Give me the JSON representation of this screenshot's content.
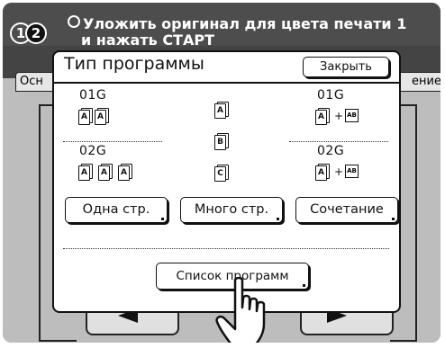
{
  "status": {
    "step1": "1",
    "step2": "2",
    "message_line1": "Уложить оригинал для цвета печати 1",
    "message_line2": "и нажать СТАРТ"
  },
  "background": {
    "tab_left_label": "Осн",
    "tab_right_label": "ение"
  },
  "dialog": {
    "title": "Тип программы",
    "close_label": "Закрыть",
    "single": {
      "code1": "01G",
      "code2": "02G",
      "button_label": "Одна стр."
    },
    "multi": {
      "icons": [
        "A",
        "B",
        "C"
      ],
      "button_label": "Много стр."
    },
    "combo": {
      "code1": "01G",
      "code2": "02G",
      "plus": "+",
      "ab": "AB",
      "button_label": "Сочетание"
    },
    "list_label": "Список программ"
  },
  "icons": {
    "pointer": "hand-pointer-icon"
  },
  "colors": {
    "topbar": "#4d4d4d",
    "panel_background": "#bdbdbd",
    "dialog_background": "#ffffff"
  }
}
